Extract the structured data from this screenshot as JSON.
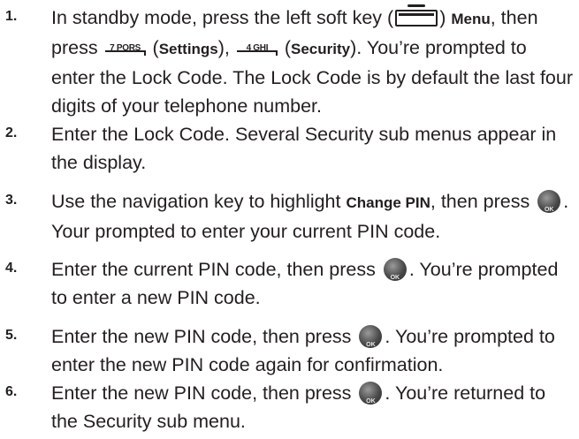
{
  "steps": [
    {
      "num": "1.",
      "pre": "In standby mode, press the left soft key (",
      "softkey_icon": "left-soft-key-icon",
      "after_key": ") ",
      "menu": "Menu",
      "comma1": ", then press ",
      "key7_label": "7 PQRS",
      "settings_open": " (",
      "settings": "Settings",
      "settings_close": "), ",
      "key4_label": "4 GHI",
      "security_open": " (",
      "security": "Security",
      "rest": "). You’re prompted to enter the Lock Code. The Lock Code is by default the last four digits of your telephone number."
    },
    {
      "num": "2.",
      "text": "Enter the Lock Code. Several Security sub menus appear in the display."
    },
    {
      "num": "3.",
      "pre": "Use the navigation key to highlight ",
      "bold": "Change PIN",
      "mid": ", then press ",
      "ok_label": "OK",
      "post": ". Your prompted to enter your current PIN code."
    },
    {
      "num": "4.",
      "pre": "Enter the current PIN code, then press ",
      "ok_label": "OK",
      "post": ". You’re prompted to enter a new PIN code."
    },
    {
      "num": "5.",
      "pre": "Enter the new PIN code, then press ",
      "ok_label": "OK",
      "post": ". You’re prompted to enter the new PIN code again for confirmation."
    },
    {
      "num": "6.",
      "pre": "Enter the new PIN code, then press ",
      "ok_label": "OK",
      "post": ". You’re returned to the Security sub menu."
    }
  ]
}
